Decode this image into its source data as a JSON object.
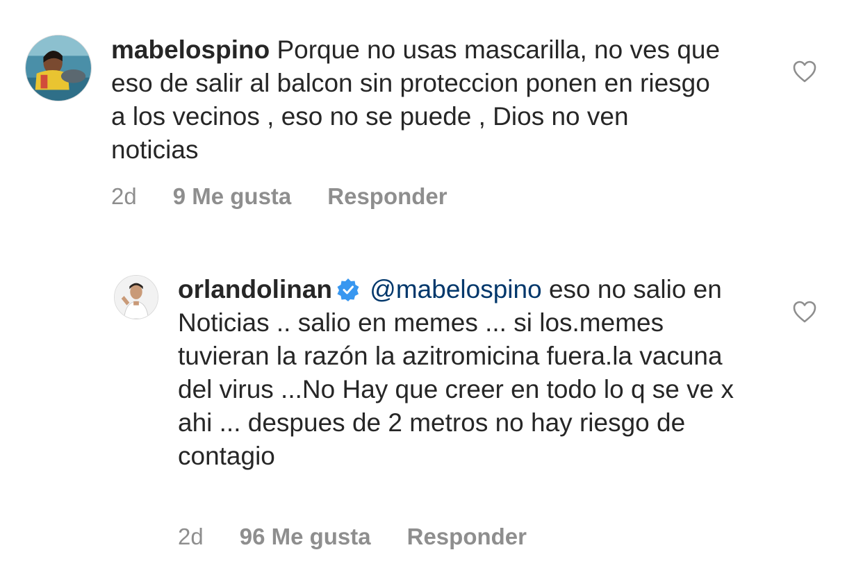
{
  "comments": [
    {
      "username": "mabelospino",
      "verified": false,
      "mention": "",
      "text": "Porque no usas mascarilla, no ves que eso de salir al balcon sin proteccion ponen en riesgo a los vecinos , eso no se puede , Dios no ven noticias",
      "time": "2d",
      "likes": "9 Me gusta",
      "reply_label": "Responder",
      "avatar_icon": "profile-photo-woman-icon",
      "like_icon": "heart-outline-icon"
    },
    {
      "username": "orlandolinan",
      "verified": true,
      "mention": "@mabelospino",
      "text": "eso no salio en Noticias .. salio en memes ... si los.memes tuvieran la razón la azitromicina fuera.la vacuna del virus ...No Hay que creer en todo lo q se ve x ahi ... despues de 2 metros no hay riesgo de contagio",
      "time": "2d",
      "likes": "96 Me gusta",
      "reply_label": "Responder",
      "avatar_icon": "profile-photo-man-icon",
      "like_icon": "heart-outline-icon"
    }
  ],
  "colors": {
    "text": "#262626",
    "secondary": "#8e8e8e",
    "mention": "#00376b",
    "verified": "#3897f0"
  }
}
